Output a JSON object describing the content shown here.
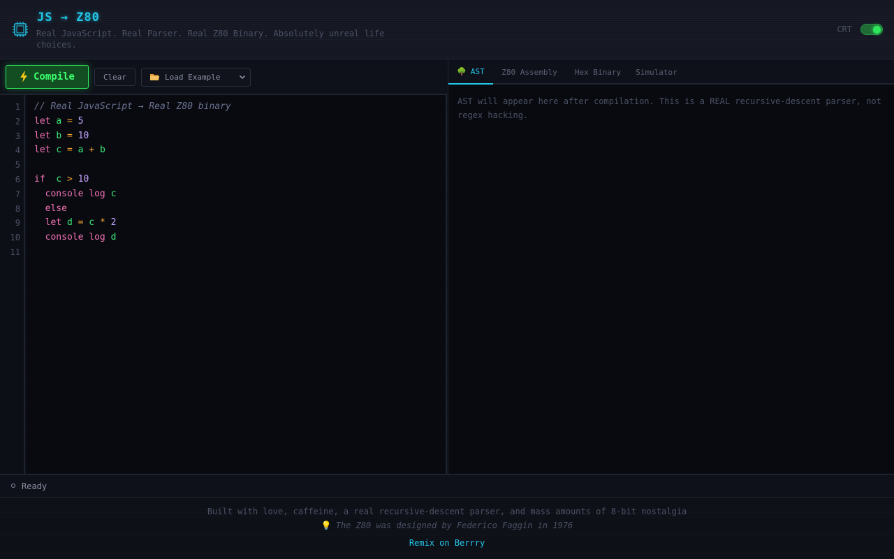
{
  "header": {
    "title": "JS → Z80",
    "tagline": "Real JavaScript. Real Parser. Real Z80 Binary. Absolutely unreal life choices.",
    "crt_label": "CRT",
    "crt_enabled": true,
    "icon": "chip-icon"
  },
  "toolbar": {
    "compile_label": "Compile",
    "compile_icon": "lightning-icon",
    "clear_label": "Clear",
    "example_select": {
      "icon": "folder-icon",
      "selected": "Load Example"
    }
  },
  "editor": {
    "line_numbers": [
      "1",
      "2",
      "3",
      "4",
      "5",
      "6",
      "7",
      "8",
      "9",
      "10",
      "11"
    ],
    "lines": [
      [
        {
          "t": "// Real JavaScript → Real Z80 binary",
          "c": "cmt"
        }
      ],
      [
        {
          "t": "let",
          "c": "kw"
        },
        {
          "t": " "
        },
        {
          "t": "a",
          "c": "var"
        },
        {
          "t": " "
        },
        {
          "t": "=",
          "c": "op"
        },
        {
          "t": " "
        },
        {
          "t": "5",
          "c": "num"
        }
      ],
      [
        {
          "t": "let",
          "c": "kw"
        },
        {
          "t": " "
        },
        {
          "t": "b",
          "c": "var"
        },
        {
          "t": " "
        },
        {
          "t": "=",
          "c": "op"
        },
        {
          "t": " "
        },
        {
          "t": "10",
          "c": "num"
        }
      ],
      [
        {
          "t": "let",
          "c": "kw"
        },
        {
          "t": " "
        },
        {
          "t": "c",
          "c": "var"
        },
        {
          "t": " "
        },
        {
          "t": "=",
          "c": "op"
        },
        {
          "t": " "
        },
        {
          "t": "a",
          "c": "var"
        },
        {
          "t": " "
        },
        {
          "t": "+",
          "c": "op"
        },
        {
          "t": " "
        },
        {
          "t": "b",
          "c": "var"
        }
      ],
      [],
      [
        {
          "t": "if",
          "c": "kw"
        },
        {
          "t": "  "
        },
        {
          "t": "c",
          "c": "var"
        },
        {
          "t": " "
        },
        {
          "t": ">",
          "c": "op"
        },
        {
          "t": " "
        },
        {
          "t": "10",
          "c": "num"
        }
      ],
      [
        {
          "t": "  "
        },
        {
          "t": "console",
          "c": "kw"
        },
        {
          "t": " "
        },
        {
          "t": "log",
          "c": "kw"
        },
        {
          "t": " "
        },
        {
          "t": "c",
          "c": "var"
        }
      ],
      [
        {
          "t": "  "
        },
        {
          "t": "else",
          "c": "kw"
        }
      ],
      [
        {
          "t": "  "
        },
        {
          "t": "let",
          "c": "kw"
        },
        {
          "t": " "
        },
        {
          "t": "d",
          "c": "var"
        },
        {
          "t": " "
        },
        {
          "t": "=",
          "c": "op"
        },
        {
          "t": " "
        },
        {
          "t": "c",
          "c": "var"
        },
        {
          "t": " "
        },
        {
          "t": "*",
          "c": "op"
        },
        {
          "t": " "
        },
        {
          "t": "2",
          "c": "num"
        }
      ],
      [
        {
          "t": "  "
        },
        {
          "t": "console",
          "c": "kw"
        },
        {
          "t": " "
        },
        {
          "t": "log",
          "c": "kw"
        },
        {
          "t": " "
        },
        {
          "t": "d",
          "c": "var"
        }
      ],
      []
    ]
  },
  "output": {
    "tabs": [
      {
        "label": "AST",
        "icon": "tree-icon",
        "active": true
      },
      {
        "label": "Z80 Assembly",
        "active": false
      },
      {
        "label": "Hex Binary",
        "active": false
      },
      {
        "label": "Simulator",
        "active": false
      }
    ],
    "placeholder": "AST will appear here after compilation. This is a REAL recursive-descent parser, not regex hacking."
  },
  "status": {
    "text": "Ready"
  },
  "footer": {
    "line1": "Built with love, caffeine, a real recursive-descent parser, and mass amounts of 8-bit nostalgia",
    "line2": "The Z80 was designed by Federico Faggin in 1976",
    "line2_icon": "lightbulb-icon",
    "remix_label": "Remix on Berrry"
  },
  "colors": {
    "accent_cyan": "#22c7e8",
    "accent_green": "#2ee85c",
    "keyword": "#f472b6",
    "variable": "#3ee876",
    "operator": "#f0a030",
    "number": "#c4a5ff",
    "comment": "#6a7290",
    "background": "#0d0f17"
  }
}
